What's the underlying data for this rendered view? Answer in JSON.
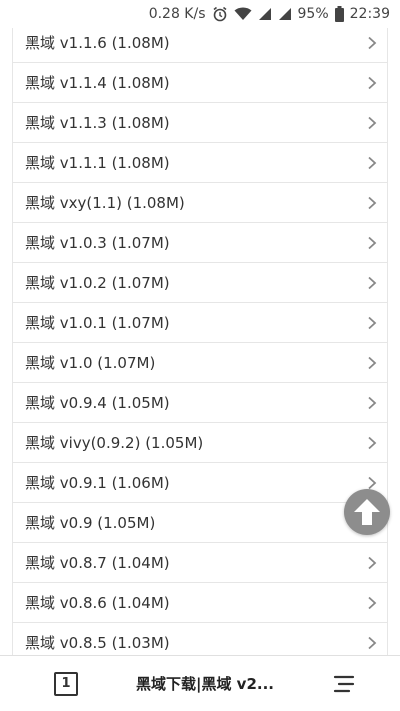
{
  "status_bar": {
    "net_speed": "0.28 K/s",
    "battery": "95%",
    "time": "22:39",
    "icons": [
      "alarm-icon",
      "wifi-icon",
      "signal-icon",
      "signal-icon",
      "battery-icon"
    ]
  },
  "versions": [
    "黑域 v1.1.6 (1.08M)",
    "黑域 v1.1.4 (1.08M)",
    "黑域 v1.1.3 (1.08M)",
    "黑域 v1.1.1 (1.08M)",
    "黑域 vxy(1.1) (1.08M)",
    "黑域 v1.0.3 (1.07M)",
    "黑域 v1.0.2 (1.07M)",
    "黑域 v1.0.1 (1.07M)",
    "黑域 v1.0 (1.07M)",
    "黑域 v0.9.4 (1.05M)",
    "黑域 vivy(0.9.2) (1.05M)",
    "黑域 v0.9.1 (1.06M)",
    "黑域 v0.9 (1.05M)",
    "黑域 v0.8.7 (1.04M)",
    "黑域 v0.8.6 (1.04M)",
    "黑域 v0.8.5 (1.03M)"
  ],
  "bottom_bar": {
    "tab_count": "1",
    "page_title": "黑域下载|黑域 v2..."
  }
}
